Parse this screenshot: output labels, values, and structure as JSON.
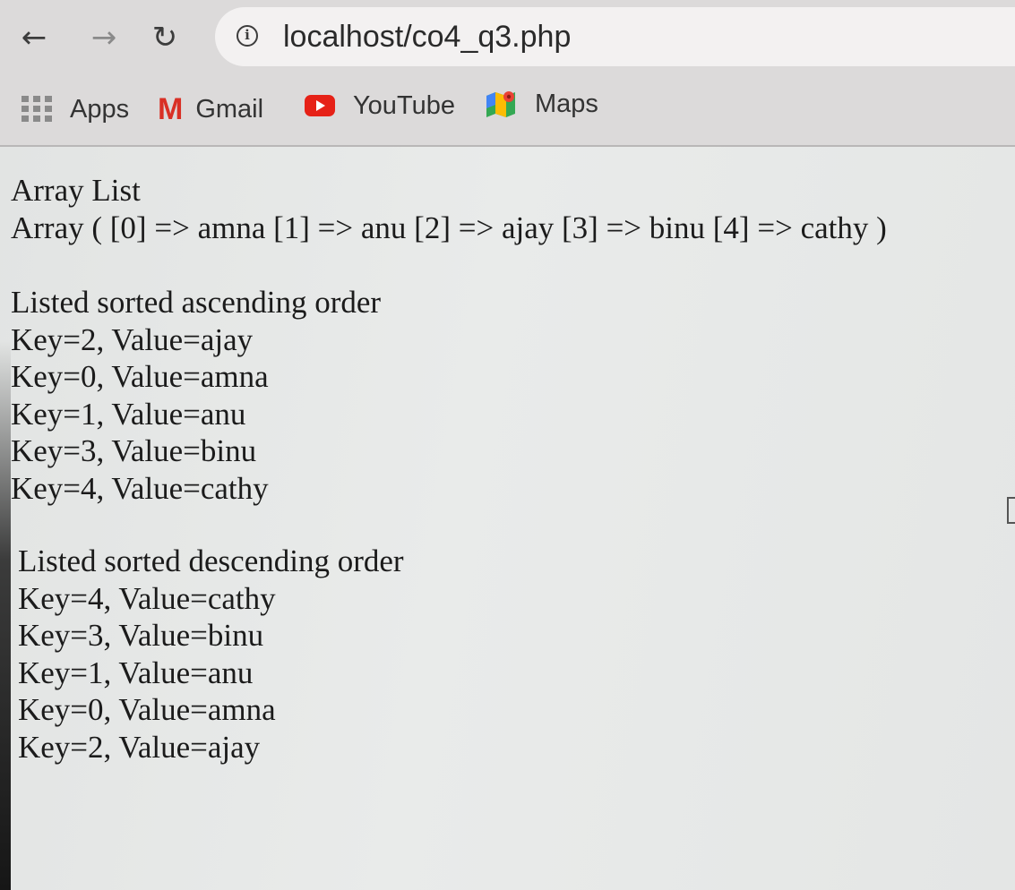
{
  "browser": {
    "url": "localhost/co4_q3.php",
    "bookmarks": [
      {
        "label": "Apps",
        "icon": "apps-grid-icon"
      },
      {
        "label": "Gmail",
        "icon": "gmail-icon"
      },
      {
        "label": "YouTube",
        "icon": "youtube-icon"
      },
      {
        "label": "Maps",
        "icon": "maps-icon"
      }
    ]
  },
  "page": {
    "heading": "Array List",
    "array_dump": "Array ( [0] => amna [1] => anu [2] => ajay [3] => binu [4] => cathy )",
    "ascending": {
      "title": "Listed sorted ascending order",
      "rows": [
        "Key=2, Value=ajay",
        "Key=0, Value=amna",
        "Key=1, Value=anu",
        "Key=3, Value=binu",
        "Key=4, Value=cathy"
      ]
    },
    "descending": {
      "title": "Listed sorted descending order",
      "rows": [
        "Key=4, Value=cathy",
        "Key=3, Value=binu",
        "Key=1, Value=anu",
        "Key=0, Value=amna",
        "Key=2, Value=ajay"
      ]
    }
  },
  "colors": {
    "chrome_bar": "#dcdada",
    "omnibox": "#f3f1f1",
    "page_bg": "#e6e8e6",
    "text": "#1b1b1b"
  }
}
